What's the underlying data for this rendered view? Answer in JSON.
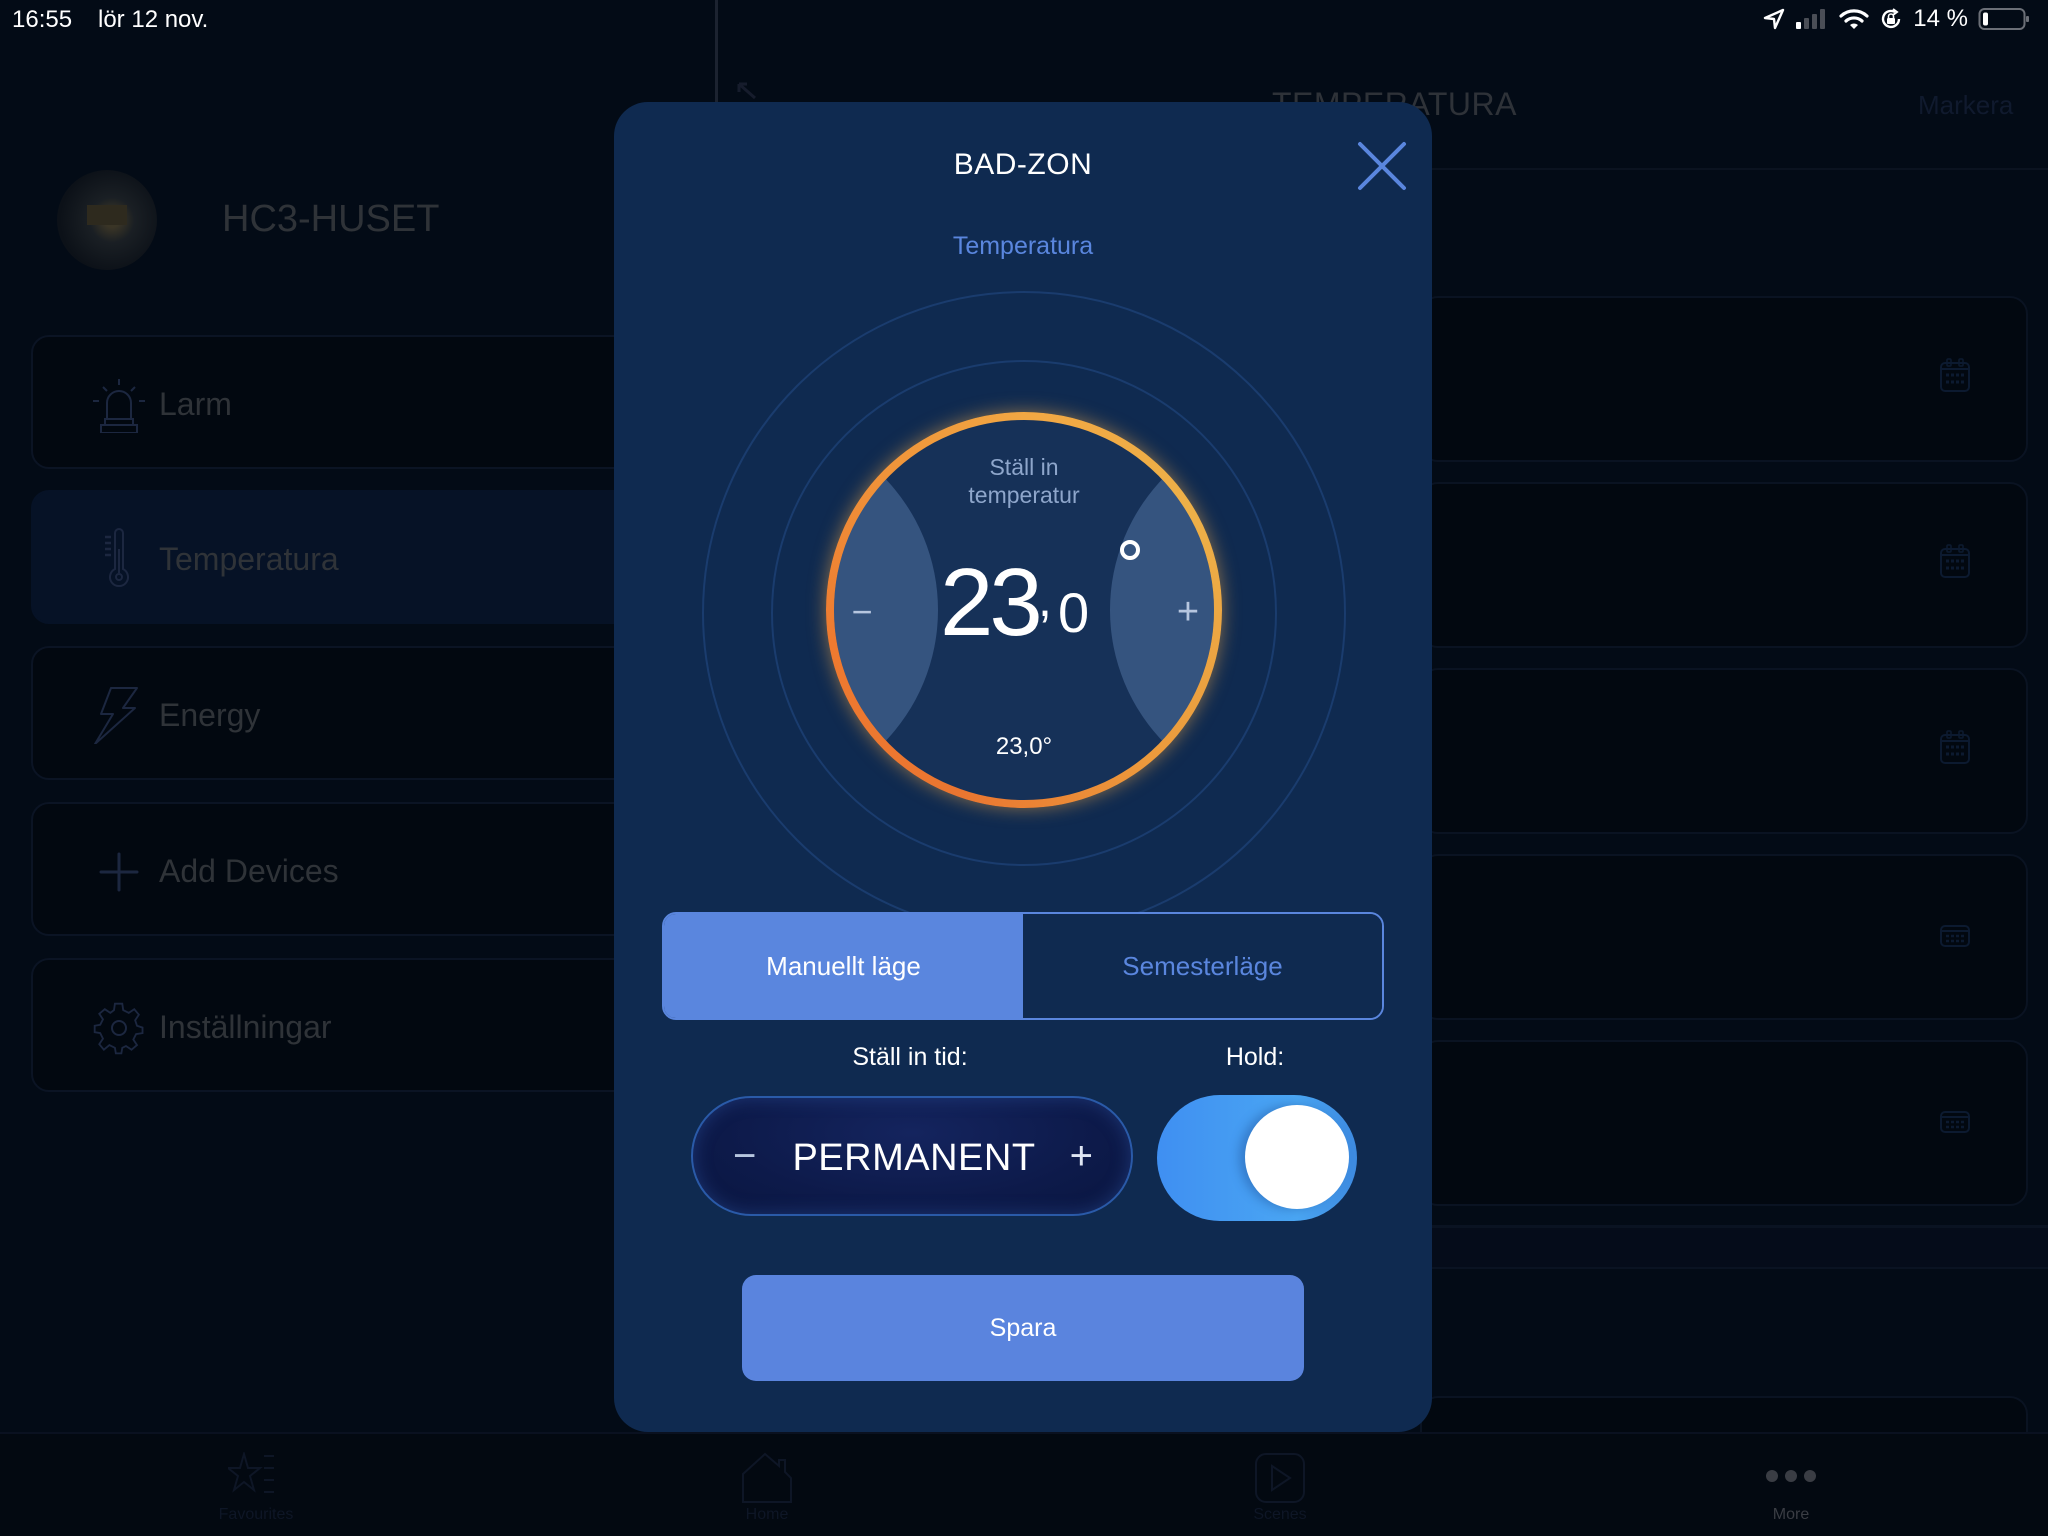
{
  "status_bar": {
    "time": "16:55",
    "date": "lör 12 nov.",
    "battery_percent": "14 %",
    "icons": [
      "location-arrow-icon",
      "cellular-signal-icon",
      "wifi-icon",
      "orientation-lock-icon",
      "battery-icon"
    ]
  },
  "sidebar": {
    "home_name": "HC3-HUSET",
    "items": [
      {
        "label": "Larm",
        "icon": "siren-icon",
        "active": false
      },
      {
        "label": "Temperatura",
        "icon": "thermometer-icon",
        "active": true
      },
      {
        "label": "Energy",
        "icon": "lightning-icon",
        "active": false
      },
      {
        "label": "Add Devices",
        "icon": "plus-icon",
        "active": false
      },
      {
        "label": "Inställningar",
        "icon": "gear-icon",
        "active": false
      }
    ]
  },
  "main": {
    "title": "TEMPERATURA",
    "action": "Markera"
  },
  "tab_bar": {
    "tabs": [
      {
        "label": "Favourites",
        "icon": "star-list-icon",
        "active": false
      },
      {
        "label": "Home",
        "icon": "house-icon",
        "active": false
      },
      {
        "label": "Scenes",
        "icon": "play-scene-icon",
        "active": false
      },
      {
        "label": "More",
        "icon": "more-dots-icon",
        "active": true
      }
    ]
  },
  "modal": {
    "title": "BAD-ZON",
    "subtitle": "Temperatura",
    "dial": {
      "label_line1": "Ställ in",
      "label_line2": "temperatur",
      "setpoint_integer": "23",
      "setpoint_comma": ",",
      "setpoint_decimal": "0",
      "current_temperature": "23,0°",
      "decrease_symbol": "−",
      "increase_symbol": "+"
    },
    "mode_segments": [
      {
        "label": "Manuellt läge",
        "selected": true
      },
      {
        "label": "Semesterläge",
        "selected": false
      }
    ],
    "duration": {
      "label": "Ställ in tid:",
      "value": "PERMANENT",
      "decrease_symbol": "−",
      "increase_symbol": "+"
    },
    "hold": {
      "label": "Hold:",
      "on": true
    },
    "save_label": "Spara",
    "colors": {
      "accent": "#5a86de",
      "background": "#0f2a50",
      "ring_warm": "#f2a743",
      "ring_hot": "#ea7530",
      "toggle_on": "#3f8ff2"
    }
  }
}
